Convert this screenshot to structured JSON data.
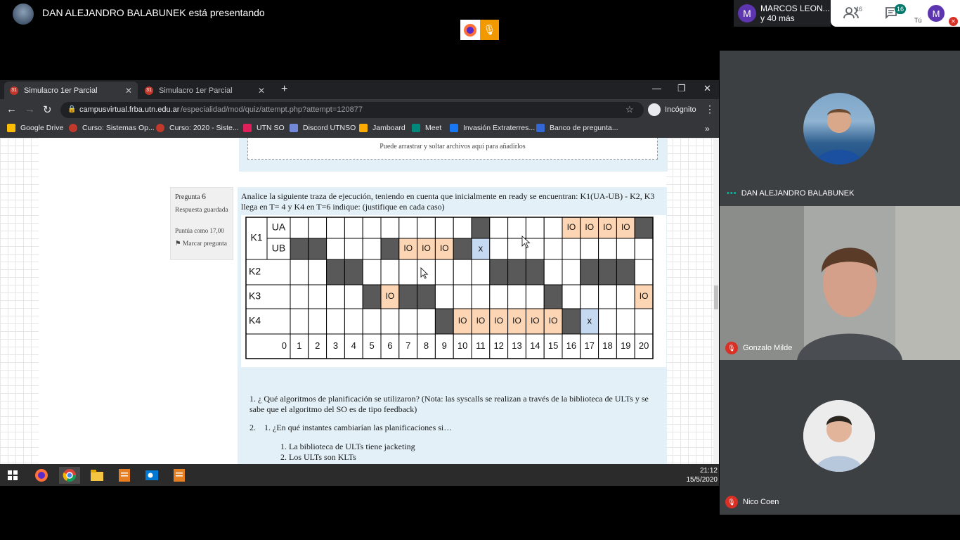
{
  "meet": {
    "presenter_text": "DAN ALEJANDRO BALABUNEK está presentando",
    "others": {
      "initial": "M",
      "name": "MARCOS LEON...",
      "more": "y 40 más"
    },
    "people_count": "46",
    "chat_count": "16",
    "self_label": "Tú",
    "self_initial": "M",
    "colors": {
      "accent_orange": "#f29900",
      "mute_red": "#d93025",
      "chat_badge": "#00796b"
    },
    "participants": [
      {
        "name": "DAN ALEJANDRO BALABUNEK"
      },
      {
        "name": "Gonzalo Milde"
      },
      {
        "name": "Nico Coen"
      }
    ]
  },
  "browser": {
    "tabs": [
      {
        "title": "Simulacro 1er Parcial"
      },
      {
        "title": "Simulacro 1er Parcial"
      }
    ],
    "url_host": "campusvirtual.frba.utn.edu.ar",
    "url_path": "/especialidad/mod/quiz/attempt.php?attempt=120877",
    "incognito_label": "Incógnito",
    "bookmarks": [
      {
        "label": "Google Drive",
        "icon": "google-drive-icon",
        "color": "#fbbc04"
      },
      {
        "label": "Curso: Sistemas Op...",
        "icon": "utn-icon",
        "color": "#c0392b"
      },
      {
        "label": "Curso: 2020 - Siste...",
        "icon": "utn-icon",
        "color": "#c0392b"
      },
      {
        "label": "UTN SO",
        "icon": "slack-icon",
        "color": "#e01e5a"
      },
      {
        "label": "Discord UTNSO",
        "icon": "discord-icon",
        "color": "#7289da"
      },
      {
        "label": "Jamboard",
        "icon": "jamboard-icon",
        "color": "#f9ab00"
      },
      {
        "label": "Meet",
        "icon": "meet-icon",
        "color": "#00897b"
      },
      {
        "label": "Invasión Extraterres...",
        "icon": "facebook-icon",
        "color": "#1877f2"
      },
      {
        "label": "Banco de pregunta...",
        "icon": "forms-icon",
        "color": "#3367d6"
      }
    ]
  },
  "quiz": {
    "upload_hint": "Puede arrastrar y soltar archivos aquí para añadirlos",
    "question_label": "Pregunta",
    "question_number": "6",
    "status": "Respuesta guardada",
    "points": "Puntúa como 17,00",
    "flag": "Marcar pregunta",
    "question_text": "Analice la siguiente traza de ejecución, teniendo en cuenta que inicialmente en ready se encuentran: K1(UA-UB)  - K2, K3 llega en T= 4 y K4 en T=6 indique: (justifique en cada caso)",
    "items": {
      "q1_num": "1.",
      "q1": "¿ Qué algoritmos de planificación se utilizaron? (Nota: las syscalls se realizan a través de la biblioteca de ULTs y se sabe que el algoritmo del SO es de tipo feedback)",
      "q2_num": "2.",
      "q2_sub_num": "1.",
      "q2": "¿En qué instantes cambiarían las planificaciones si…",
      "q2a_num": "1.",
      "q2a": "La biblioteca de ULTs tiene jacketing",
      "q2b_num": "2.",
      "q2b": "Los ULTs son KLTs"
    }
  },
  "trace": {
    "rows": [
      {
        "label": "K1",
        "sub": "UA",
        "cells": [
          "",
          "",
          "",
          "",
          "",
          "",
          "",
          "",
          "",
          "",
          "D",
          "",
          "",
          "",
          "",
          "IO",
          "IO",
          "IO",
          "IO",
          "D"
        ]
      },
      {
        "label": "K1",
        "sub": "UB",
        "cells": [
          "D",
          "D",
          "",
          "",
          "",
          "D",
          "IO",
          "IO",
          "IO",
          "D",
          "x",
          "",
          "",
          "",
          "",
          "",
          "",
          "",
          "",
          ""
        ]
      },
      {
        "label": "K2",
        "sub": "",
        "cells": [
          "",
          "",
          "D",
          "D",
          "",
          "",
          "",
          "",
          "",
          "",
          "",
          "D",
          "D",
          "D",
          "",
          "",
          "D",
          "D",
          "D",
          ""
        ]
      },
      {
        "label": "K3",
        "sub": "",
        "cells": [
          "",
          "",
          "",
          "",
          "D",
          "IO",
          "D",
          "D",
          "",
          "",
          "",
          "",
          "",
          "",
          "D",
          "",
          "",
          "",
          "",
          "IO"
        ]
      },
      {
        "label": "K4",
        "sub": "",
        "cells": [
          "",
          "",
          "",
          "",
          "",
          "",
          "",
          "",
          "D",
          "IO",
          "IO",
          "IO",
          "IO",
          "IO",
          "IO",
          "D",
          "x",
          "",
          "",
          ""
        ]
      }
    ],
    "times": [
      "0",
      "1",
      "2",
      "3",
      "4",
      "5",
      "6",
      "7",
      "8",
      "9",
      "10",
      "11",
      "12",
      "13",
      "14",
      "15",
      "16",
      "17",
      "18",
      "19",
      "20"
    ],
    "colors": {
      "dark": "#595959",
      "io": "#fcd5b4",
      "x": "#c5d9f1"
    }
  },
  "taskbar": {
    "time": "21:12",
    "date": "15/5/2020"
  }
}
